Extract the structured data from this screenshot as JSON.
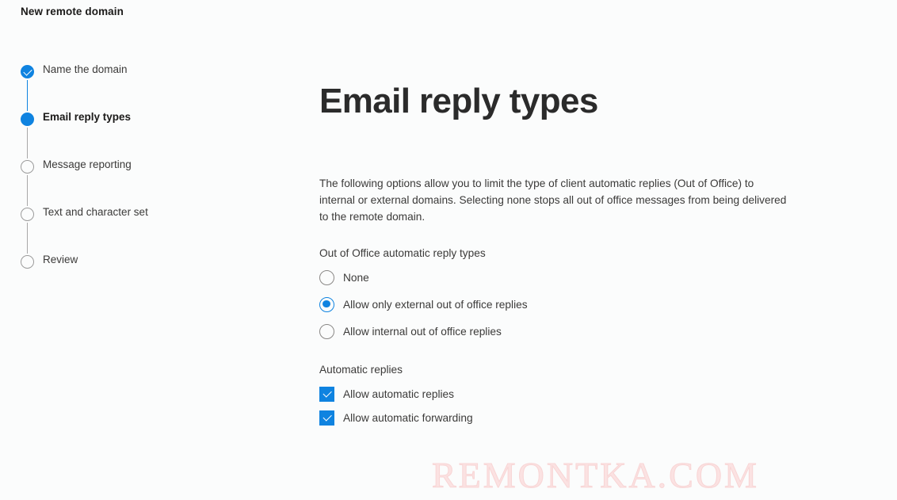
{
  "window": {
    "title": "New remote domain"
  },
  "colors": {
    "accent": "#0f83e0",
    "background": "#fbfcfc",
    "text": "#3b3a39",
    "inactive_step": "#9b9b9b",
    "watermark": "#fbe2e2"
  },
  "wizard": {
    "steps": [
      {
        "label": "Name the domain",
        "state": "done"
      },
      {
        "label": "Email reply types",
        "state": "current"
      },
      {
        "label": "Message reporting",
        "state": "todo"
      },
      {
        "label": "Text and character set",
        "state": "todo"
      },
      {
        "label": "Review",
        "state": "todo"
      }
    ]
  },
  "main": {
    "heading": "Email reply types",
    "description": "The following options allow you to limit the type of client automatic replies (Out of Office) to internal or external domains. Selecting none stops all out of office messages from being delivered to the remote domain.",
    "radio_group": {
      "title": "Out of Office automatic reply types",
      "selected_index": 1,
      "options": [
        {
          "label": "None",
          "checked": false
        },
        {
          "label": "Allow only external out of office replies",
          "checked": true
        },
        {
          "label": "Allow internal out of office replies",
          "checked": false
        }
      ]
    },
    "checkbox_group": {
      "title": "Automatic replies",
      "options": [
        {
          "label": "Allow automatic replies",
          "checked": true
        },
        {
          "label": "Allow automatic forwarding",
          "checked": true
        }
      ]
    }
  },
  "watermark": {
    "text": "REMONTKA.COM"
  }
}
